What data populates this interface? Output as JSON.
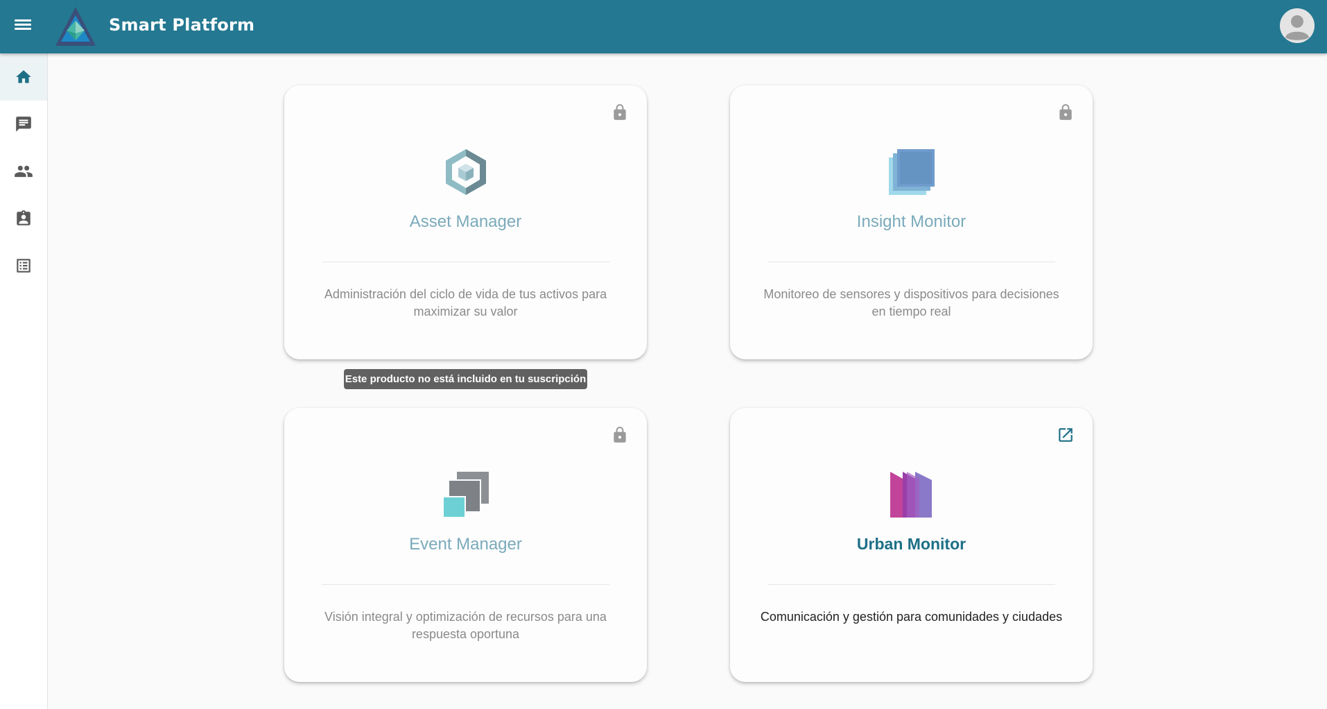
{
  "header": {
    "app_title": "Smart Platform",
    "menu_icon": "menu-icon",
    "avatar_icon": "account-avatar-icon",
    "background": "#247891"
  },
  "sidebar": {
    "items": [
      {
        "name": "home",
        "icon": "home-icon",
        "active": true
      },
      {
        "name": "messages",
        "icon": "chat-icon",
        "active": false
      },
      {
        "name": "users",
        "icon": "people-icon",
        "active": false
      },
      {
        "name": "assignments",
        "icon": "assignment-ind-icon",
        "active": false
      },
      {
        "name": "list",
        "icon": "list-alt-icon",
        "active": false
      }
    ],
    "active_color": "#1d6f86",
    "icon_color": "#5a5a5a"
  },
  "cards": [
    {
      "title": "Asset Manager",
      "description": "Administración del ciclo de vida de tus activos para maximizar su valor",
      "status_icon": "lock-icon",
      "locked": true
    },
    {
      "title": "Insight Monitor",
      "description": "Monitoreo de sensores y dispositivos para decisiones en tiempo real",
      "status_icon": "lock-icon",
      "locked": true
    },
    {
      "title": "Event Manager",
      "description": "Visión integral y optimización de recursos para una respuesta oportuna",
      "status_icon": "lock-icon",
      "locked": true
    },
    {
      "title": "Urban Monitor",
      "description": "Comunicación y gestión para comunidades y ciudades",
      "status_icon": "open-in-new-icon",
      "locked": false
    }
  ],
  "tooltip": {
    "text": "Este producto no está incluido en tu suscripción"
  },
  "colors": {
    "accent": "#247891",
    "title_locked": "#7aaabb",
    "title_active": "#1d6f86",
    "lock_icon": "#9a9a9a"
  }
}
